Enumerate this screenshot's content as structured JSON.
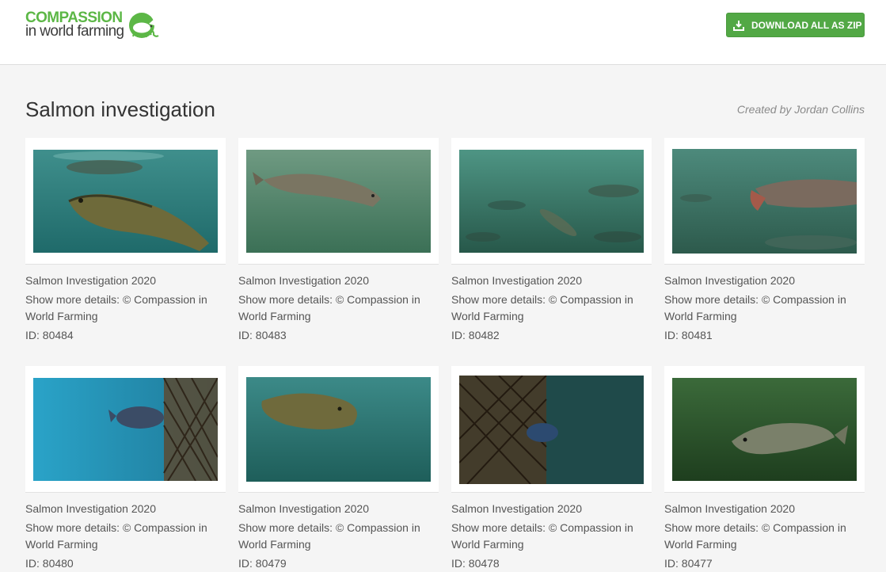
{
  "header": {
    "logo_line1": "COMPASSION",
    "logo_line2": "in world farming",
    "download_zip_label": "DOWNLOAD ALL AS ZIP",
    "brand_color": "#52a845"
  },
  "page": {
    "title": "Salmon investigation",
    "created_by": "Created by Jordan Collins"
  },
  "items": [
    {
      "title": "Salmon Investigation 2020",
      "details": "Show more details: © Compassion in World Farming",
      "id_label": "ID: 80484"
    },
    {
      "title": "Salmon Investigation 2020",
      "details": "Show more details: © Compassion in World Farming",
      "id_label": "ID: 80483"
    },
    {
      "title": "Salmon Investigation 2020",
      "details": "Show more details: © Compassion in World Farming",
      "id_label": "ID: 80482"
    },
    {
      "title": "Salmon Investigation 2020",
      "details": "Show more details: © Compassion in World Farming",
      "id_label": "ID: 80481"
    },
    {
      "title": "Salmon Investigation 2020",
      "details": "Show more details: © Compassion in World Farming",
      "id_label": "ID: 80480"
    },
    {
      "title": "Salmon Investigation 2020",
      "details": "Show more details: © Compassion in World Farming",
      "id_label": "ID: 80479"
    },
    {
      "title": "Salmon Investigation 2020",
      "details": "Show more details: © Compassion in World Farming",
      "id_label": "ID: 80478"
    },
    {
      "title": "Salmon Investigation 2020",
      "details": "Show more details: © Compassion in World Farming",
      "id_label": "ID: 80477"
    }
  ]
}
